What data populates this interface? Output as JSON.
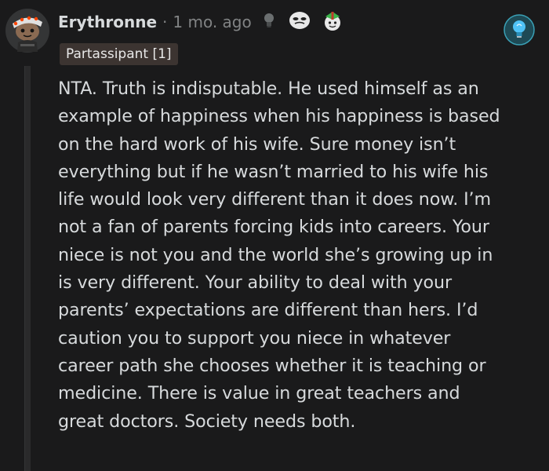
{
  "comment": {
    "username": "Erythronne",
    "separator": "·",
    "timestamp": "1 mo. ago",
    "flair": "Partassipant [1]",
    "awards": [
      "lightbulb-award-icon",
      "face-award-icon",
      "gift-award-icon"
    ],
    "badge_icon": "lightbulb-badge-icon",
    "body_lines": [
      "NTA. Truth is indisputable. He used himself as an",
      "example of happiness when his happiness is based",
      "on the hard work of his wife. Sure money isn’t",
      "everything but if he wasn’t married to his wife his",
      "life would look very different than it does now. I’m",
      "not a fan of parents forcing kids into careers. Your",
      "niece is not you and the world she’s growing up in",
      "is very different. Your ability to deal with your",
      "parents’ expectations are different than hers. I’d",
      "caution you to support you niece in whatever",
      "career path she chooses whether it is teaching or",
      "medicine. There is value in great teachers and",
      "great doctors. Society needs both."
    ]
  },
  "colors": {
    "background": "#1a1a1b",
    "text": "#d7dadc",
    "muted": "#818384",
    "flair_bg": "#3c3431",
    "badge": "#4fc3f7"
  }
}
